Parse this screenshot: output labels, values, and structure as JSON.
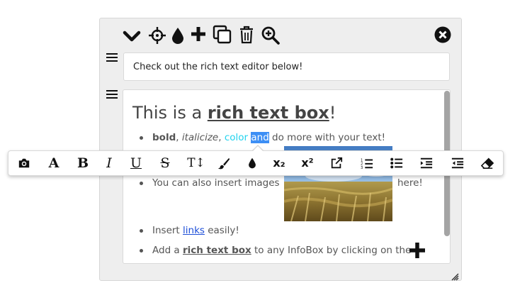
{
  "header_icons": [
    "chevron-down-icon",
    "move-crosshair-icon",
    "color-drop-icon",
    "plus-icon",
    "duplicate-icon",
    "trash-icon",
    "zoom-in-icon",
    "close-circle-icon"
  ],
  "text_field": {
    "value": "Check out the rich text editor below!"
  },
  "editor": {
    "title_prefix": "This is a ",
    "title_bold": "rich text box",
    "title_suffix": "!",
    "line1": {
      "bold": "bold",
      "sep1": ", ",
      "italic": "italicize",
      "sep2": ", ",
      "color_word": "color",
      "space": " ",
      "selected": "and",
      "rest": " do more with your text!"
    },
    "line2": {
      "text": "You can also insert images",
      "after": "here!"
    },
    "line3": {
      "before": "Insert ",
      "link": "links",
      "after": " easily!"
    },
    "line4": {
      "before": "Add a ",
      "bold": "rich text box",
      "after": " to any InfoBox by clicking on the"
    }
  },
  "toolbar": {
    "buttons": [
      {
        "name": "insert-image",
        "glyph": ""
      },
      {
        "name": "font-family",
        "glyph": "A"
      },
      {
        "name": "bold",
        "glyph": "B"
      },
      {
        "name": "italic",
        "glyph": "I"
      },
      {
        "name": "underline",
        "glyph": "U"
      },
      {
        "name": "strikethrough",
        "glyph": "S"
      },
      {
        "name": "font-size",
        "glyph": "T↕"
      },
      {
        "name": "text-color",
        "glyph": ""
      },
      {
        "name": "background-color",
        "glyph": ""
      },
      {
        "name": "subscript",
        "glyph": "x₂"
      },
      {
        "name": "superscript",
        "glyph": "x²"
      },
      {
        "name": "insert-link",
        "glyph": ""
      },
      {
        "name": "ordered-list",
        "glyph": ""
      },
      {
        "name": "unordered-list",
        "glyph": ""
      },
      {
        "name": "indent",
        "glyph": ""
      },
      {
        "name": "outdent",
        "glyph": ""
      },
      {
        "name": "clear-formatting",
        "glyph": ""
      }
    ]
  }
}
